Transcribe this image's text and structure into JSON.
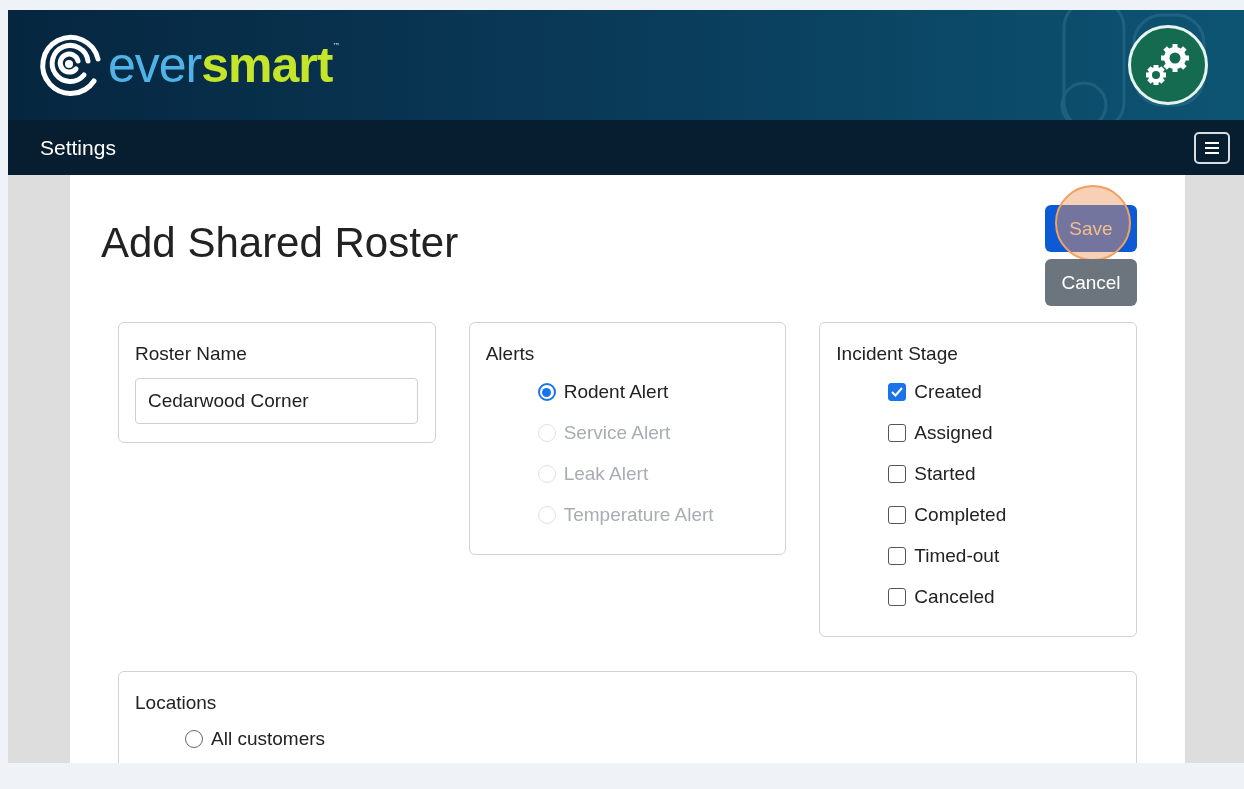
{
  "header": {
    "logo": {
      "light": "ever",
      "bold": "smart",
      "mark": "™"
    }
  },
  "navbar": {
    "title": "Settings"
  },
  "page": {
    "title": "Add Shared Roster",
    "buttons": [
      {
        "label": "Save",
        "kind": "primary",
        "highlighted": true
      },
      {
        "label": "Cancel",
        "kind": "secondary",
        "highlighted": false
      }
    ]
  },
  "roster_name": {
    "label": "Roster Name",
    "value": "Cedarwood Corner"
  },
  "alerts": {
    "label": "Alerts",
    "options": [
      {
        "label": "Rodent Alert",
        "selected": true,
        "disabled": false
      },
      {
        "label": "Service Alert",
        "selected": false,
        "disabled": true
      },
      {
        "label": "Leak Alert",
        "selected": false,
        "disabled": true
      },
      {
        "label": "Temperature Alert",
        "selected": false,
        "disabled": true
      }
    ]
  },
  "incident_stage": {
    "label": "Incident Stage",
    "options": [
      {
        "label": "Created",
        "checked": true
      },
      {
        "label": "Assigned",
        "checked": false
      },
      {
        "label": "Started",
        "checked": false
      },
      {
        "label": "Completed",
        "checked": false
      },
      {
        "label": "Timed-out",
        "checked": false
      },
      {
        "label": "Canceled",
        "checked": false
      }
    ]
  },
  "locations": {
    "label": "Locations",
    "options": [
      {
        "label": "All customers",
        "selected": false
      }
    ]
  }
}
